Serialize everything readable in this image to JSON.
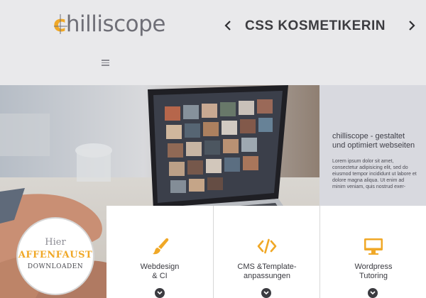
{
  "header": {
    "logo": {
      "first": "c",
      "rest": "hilliscope"
    },
    "slider_title": "CSS KOSMETIKERIN"
  },
  "hero": {
    "heading": "chilliscope - gestaltet und optimiert webseiten",
    "text": "Lorem ipsum dolor sit amet, consectetur adipisicing elit, sed do eiusmod tempor incididunt ut labore et dolore magna aliqua. Ut enim ad minim veniam, quis nostrud exer-"
  },
  "badge": {
    "line1": "Hier",
    "line2": "AFFENFAUST",
    "line3": "DOWNLOADEN"
  },
  "cards": [
    {
      "label": "Webdesign\n& CI",
      "icon": "paintbrush-icon"
    },
    {
      "label": "CMS &Template-\nanpassungen",
      "icon": "code-icon"
    },
    {
      "label": "Wordpress\nTutoring",
      "icon": "monitor-icon"
    }
  ],
  "colors": {
    "accent": "#f0a827",
    "header_bg": "#e9e9eb",
    "panel_bg": "#d8d9df",
    "dark": "#3b3b40"
  }
}
